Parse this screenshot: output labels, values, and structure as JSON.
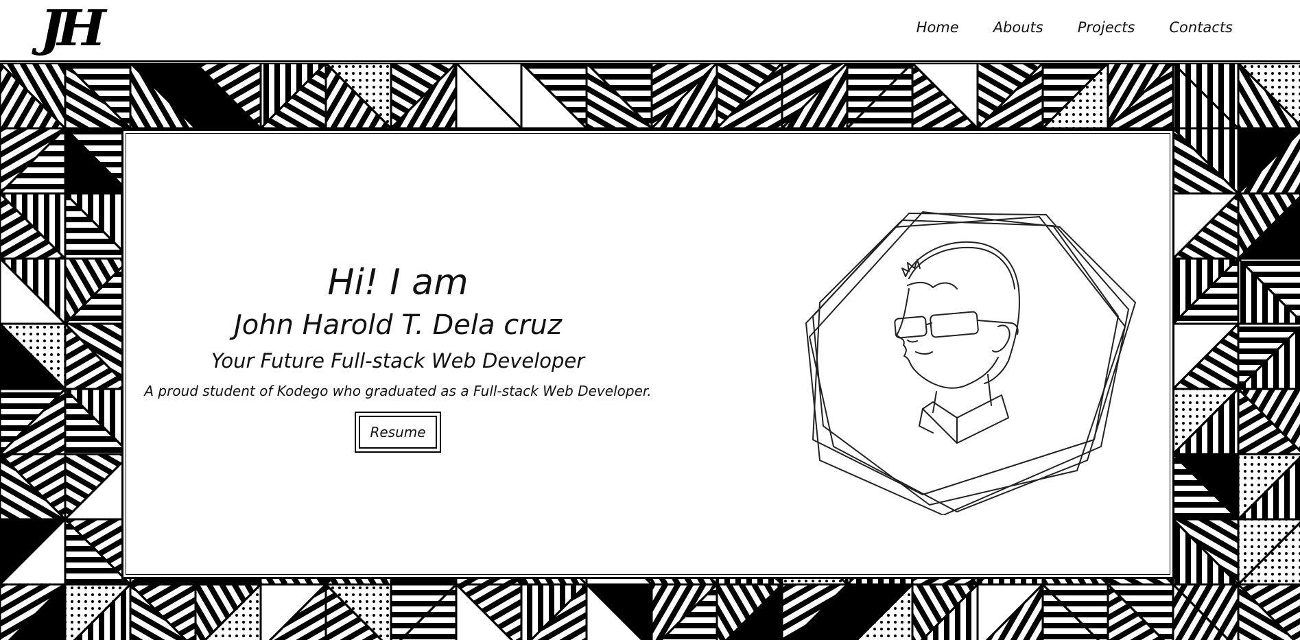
{
  "header": {
    "logo": "JH",
    "nav": [
      {
        "label": "Home"
      },
      {
        "label": "Abouts"
      },
      {
        "label": "Projects"
      },
      {
        "label": "Contacts"
      }
    ]
  },
  "hero": {
    "greeting": "Hi! I am",
    "name": "John Harold T. Dela cruz",
    "tagline": "Your Future Full-stack Web Developer",
    "description": "A proud student of Kodego who graduated as a Full-stack Web Developer.",
    "resume_label": "Resume"
  },
  "colors": {
    "ink": "#000000",
    "paper": "#ffffff"
  }
}
